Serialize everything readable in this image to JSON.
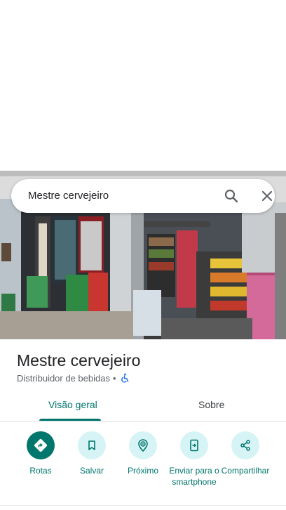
{
  "search": {
    "query": "Mestre cervejeiro"
  },
  "place": {
    "title": "Mestre cervejeiro",
    "category": "Distribuidor de bebidas",
    "separator": "•"
  },
  "tabs": [
    {
      "label": "Visão geral",
      "selected": true
    },
    {
      "label": "Sobre",
      "selected": false
    }
  ],
  "actions": [
    {
      "label": "Rotas",
      "icon": "directions-icon"
    },
    {
      "label": "Salvar",
      "icon": "bookmark-icon"
    },
    {
      "label": "Próximo",
      "icon": "nearby-icon"
    },
    {
      "label": "Enviar para o smartphone",
      "icon": "send-to-phone-icon"
    },
    {
      "label": "Compartilhar",
      "icon": "share-icon"
    }
  ],
  "colors": {
    "accent": "#00766c",
    "chip_bg": "#d6f4f6",
    "text_primary": "#202124",
    "text_secondary": "#5f6368"
  }
}
